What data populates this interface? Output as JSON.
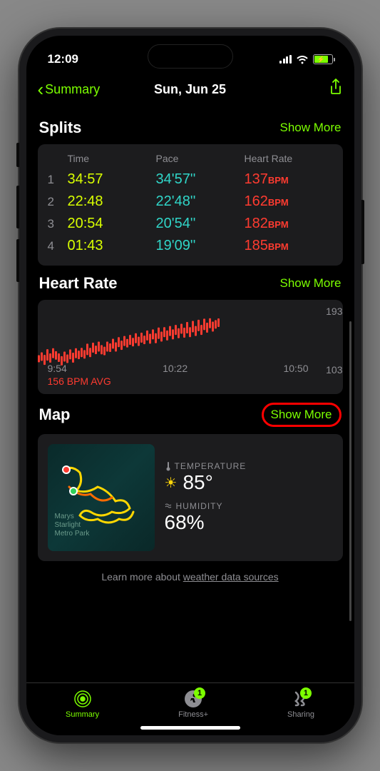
{
  "status": {
    "time": "12:09"
  },
  "nav": {
    "back_label": "Summary",
    "title": "Sun, Jun 25"
  },
  "splits": {
    "title": "Splits",
    "show_more": "Show More",
    "headers": {
      "time": "Time",
      "pace": "Pace",
      "hr": "Heart Rate"
    },
    "rows": [
      {
        "n": "1",
        "time": "34:57",
        "pace": "34'57''",
        "hr": "137",
        "bpm": "BPM"
      },
      {
        "n": "2",
        "time": "22:48",
        "pace": "22'48''",
        "hr": "162",
        "bpm": "BPM"
      },
      {
        "n": "3",
        "time": "20:54",
        "pace": "20'54''",
        "hr": "182",
        "bpm": "BPM"
      },
      {
        "n": "4",
        "time": "01:43",
        "pace": "19'09''",
        "hr": "185",
        "bpm": "BPM"
      }
    ]
  },
  "heart_rate": {
    "title": "Heart Rate",
    "show_more": "Show More",
    "avg_label": "156 BPM AVG",
    "xlabels": [
      "9:54",
      "10:22",
      "10:50"
    ]
  },
  "chart_data": {
    "type": "line",
    "title": "Heart Rate",
    "ylabel": "BPM",
    "ylim": [
      103,
      193
    ],
    "xticks": [
      "9:54",
      "10:22",
      "10:50"
    ],
    "series": [
      {
        "name": "Heart Rate",
        "avg": 156,
        "values": [
          128,
          132,
          126,
          135,
          130,
          138,
          134,
          130,
          125,
          132,
          128,
          136,
          130,
          138,
          135,
          140,
          136,
          145,
          140,
          148,
          144,
          150,
          145,
          142,
          150,
          148,
          155,
          150,
          158,
          153,
          160,
          156,
          162,
          158,
          165,
          160,
          166,
          162,
          170,
          164,
          172,
          165,
          174,
          168,
          176,
          170,
          178,
          172,
          180,
          174,
          182,
          175,
          184,
          176,
          186,
          178,
          188,
          180,
          190,
          184,
          192,
          186,
          190,
          193
        ]
      }
    ]
  },
  "map": {
    "title": "Map",
    "show_more": "Show More",
    "park_label": "Marys... Starlight Metro Park",
    "temp_label": "TEMPERATURE",
    "temp_value": "85°",
    "humidity_label": "HUMIDITY",
    "humidity_value": "68%",
    "weather_link_pre": "Learn more about ",
    "weather_link": "weather data sources"
  },
  "tabs": {
    "summary": "Summary",
    "fitness": "Fitness+",
    "sharing": "Sharing",
    "badge1": "1",
    "badge2": "1"
  }
}
